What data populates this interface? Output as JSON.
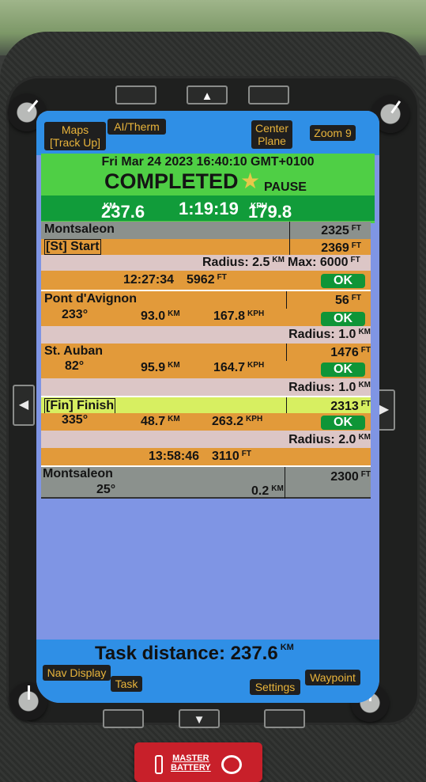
{
  "softkeys": {
    "maps": "Maps\n[Track Up]",
    "ai_therm": "AI/Therm",
    "center_plane": "Center\nPlane",
    "zoom": "Zoom 9",
    "nav_display": "Nav Display",
    "task": "Task",
    "settings": "Settings",
    "waypoint": "Waypoint"
  },
  "status": {
    "datetime": "Fri Mar 24 2023 16:40:10 GMT+0100",
    "state": "COMPLETED",
    "pause": "PAUSE",
    "distance": "237.6",
    "distance_unit": "KM",
    "elapsed": "1:19:19",
    "speed": "179.8",
    "speed_unit": "KPH"
  },
  "waypoints": {
    "montsaleon_1": {
      "name": "Montsaleon",
      "alt": "2325",
      "alt_unit": "FT"
    },
    "start": {
      "name": "[St] Start",
      "alt": "2369",
      "alt_unit": "FT",
      "radius": "Radius: 2.5",
      "radius_unit": "KM",
      "max": "Max: 6000",
      "max_unit": "FT",
      "time": "12:27:34",
      "time_alt": "5962",
      "time_alt_unit": "FT",
      "ok": "OK"
    },
    "pont": {
      "name": "Pont d'Avignon",
      "alt": "56",
      "alt_unit": "FT",
      "heading": "233°",
      "dist": "93.0",
      "dist_unit": "KM",
      "speed": "167.8",
      "speed_unit": "KPH",
      "ok": "OK",
      "radius": "Radius: 1.0",
      "radius_unit": "KM"
    },
    "auban": {
      "name": "St. Auban",
      "alt": "1476",
      "alt_unit": "FT",
      "heading": "82°",
      "dist": "95.9",
      "dist_unit": "KM",
      "speed": "164.7",
      "speed_unit": "KPH",
      "ok": "OK",
      "radius": "Radius: 1.0",
      "radius_unit": "KM"
    },
    "finish": {
      "name": "[Fin] Finish",
      "alt": "2313",
      "alt_unit": "FT",
      "heading": "335°",
      "dist": "48.7",
      "dist_unit": "KM",
      "speed": "263.2",
      "speed_unit": "KPH",
      "ok": "OK",
      "radius": "Radius: 2.0",
      "radius_unit": "KM",
      "time": "13:58:46",
      "time_alt": "3110",
      "time_alt_unit": "FT"
    },
    "montsaleon_2": {
      "name": "Montsaleon",
      "alt": "2300",
      "alt_unit": "FT",
      "heading": "25°",
      "dist": "0.2",
      "dist_unit": "KM"
    }
  },
  "task_distance": {
    "label": "Task distance: 237.6",
    "unit": "KM"
  },
  "hardware": {
    "up_arrow": "▲",
    "down_arrow": "▼",
    "left_arrow": "◀",
    "right_arrow": "▶",
    "master_battery": "MASTER\nBATTERY"
  },
  "colors": {
    "topbar_blue": "#2f8fe6",
    "status_green": "#4fcf45",
    "stats_green": "#119c3a",
    "waypoint_orange": "#e29a3a",
    "finish_lime": "#d7ef61",
    "map_blue": "#7f95e4",
    "softkey_text": "#e9b43b"
  }
}
